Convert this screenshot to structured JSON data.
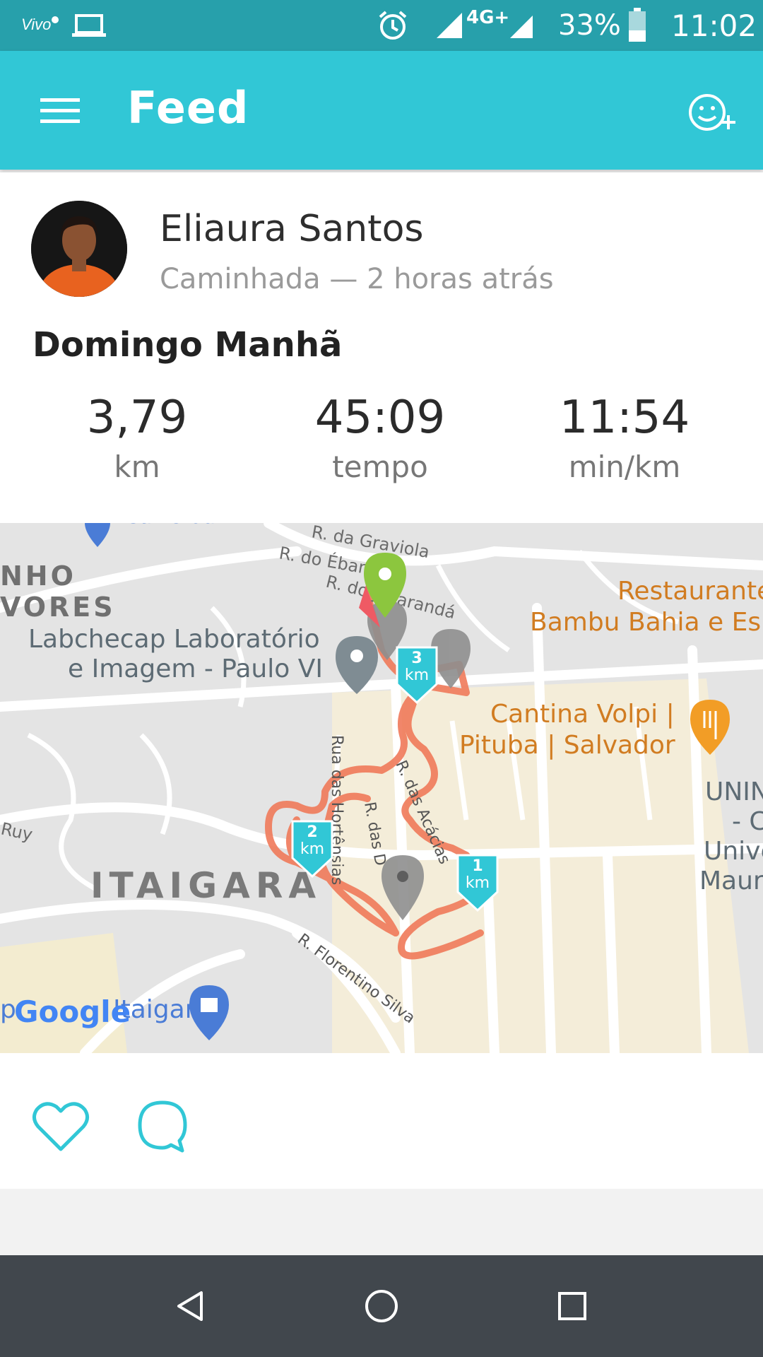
{
  "status_bar": {
    "network": "4G+",
    "battery": "33%",
    "time": "11:02",
    "icons": [
      "vivo-logo-icon",
      "laptop-icon",
      "alarm-icon",
      "signal-icon",
      "battery-icon"
    ]
  },
  "app_bar": {
    "title": "Feed",
    "menu_icon": "hamburger-menu-icon",
    "action_icon": "add-friend-smiley-icon"
  },
  "post": {
    "user_name": "Eliaura Santos",
    "subtitle": "Caminhada — 2 horas atrás",
    "activity_title": "Domingo Manhã",
    "stats": [
      {
        "value": "3,79",
        "unit": "km"
      },
      {
        "value": "45:09",
        "unit": "tempo"
      },
      {
        "value": "11:54",
        "unit": "min/km"
      }
    ]
  },
  "map": {
    "labels": {
      "graviola": "R. da Graviola",
      "ebano": "R. do Ébano",
      "randi": "R. do Jacarandá",
      "nho": "NHO",
      "vores": "VORES",
      "carrefour": "Carrefour",
      "lab1": "Labchecap Laboratório",
      "lab2": "e Imagem - Paulo VI",
      "rest1": "Restaurante",
      "rest2": "Bambu Bahia e Es",
      "cantina1": "Cantina Volpi |",
      "cantina2": "Pituba | Salvador",
      "unin1": "UNIN",
      "unin2": "- C",
      "unin3": "Unive",
      "unin4": "Maur",
      "ruy": "Ruy",
      "hortensias": "Rua das Hortênsias",
      "rdasd": "R. das D",
      "acacias": "R. das Acácias",
      "itaigara": "ITAIGARA",
      "florentino": "R. Florentino Silva",
      "shop": "Itaigara",
      "shop_prefix": "p",
      "google": "Google"
    },
    "markers": {
      "km1_num": "1",
      "km1_unit": "km",
      "km2_num": "2",
      "km2_unit": "km",
      "km3_num": "3",
      "km3_unit": "km"
    },
    "route_color": "#f07a5a",
    "marker_color": "#31c7d6"
  },
  "actions": {
    "like_icon": "heart-outline-icon",
    "comment_icon": "comment-bubble-icon"
  },
  "nav_bar": {
    "icons": [
      "back-triangle-icon",
      "home-circle-icon",
      "recents-square-icon"
    ]
  },
  "colors": {
    "status_bar": "#27a0ab",
    "app_bar": "#31c7d6",
    "accent": "#31c7d6",
    "nav_bar": "#41474d"
  }
}
